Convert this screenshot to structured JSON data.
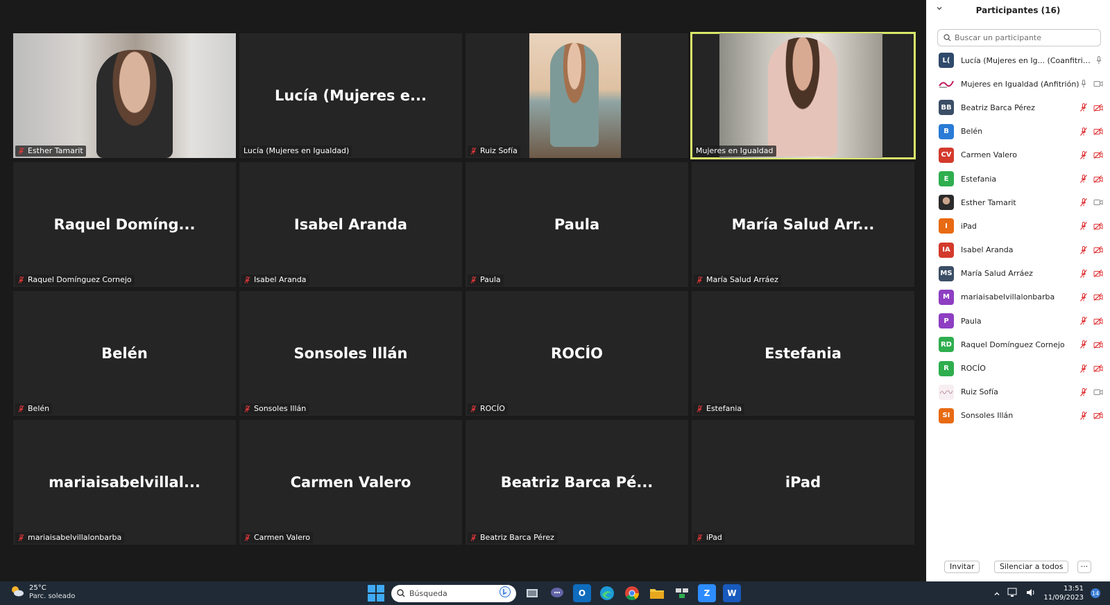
{
  "participants_panel": {
    "title": "Participantes (16)",
    "search_placeholder": "Buscar un participante",
    "participants": [
      {
        "avatar": "L(",
        "name": "Lucía (Mujeres en Ig... (Coanfitrión, yo)",
        "color": "#2f4a6b",
        "mic": "on",
        "video": "none"
      },
      {
        "avatar": "",
        "name": "Mujeres en Igualdad (Anfitrión)",
        "color": "#ffffff",
        "mic": "on",
        "video": "on",
        "avatar_icon": "mujeres-logo-icon"
      },
      {
        "avatar": "BB",
        "name": "Beatriz Barca Pérez",
        "color": "#3b4e66",
        "mic": "off",
        "video": "off"
      },
      {
        "avatar": "B",
        "name": "Belén",
        "color": "#2a7bd6",
        "mic": "off",
        "video": "off"
      },
      {
        "avatar": "CV",
        "name": "Carmen Valero",
        "color": "#d33b2c",
        "mic": "off",
        "video": "off"
      },
      {
        "avatar": "E",
        "name": "Estefania",
        "color": "#2fae4e",
        "mic": "off",
        "video": "off"
      },
      {
        "avatar": "",
        "name": "Esther Tamarit",
        "color": "#6b5a4e",
        "mic": "off",
        "video": "on",
        "avatar_icon": "photo-avatar-icon"
      },
      {
        "avatar": "I",
        "name": "iPad",
        "color": "#e86a12",
        "mic": "off",
        "video": "off"
      },
      {
        "avatar": "IA",
        "name": "Isabel Aranda",
        "color": "#d33b2c",
        "mic": "off",
        "video": "off"
      },
      {
        "avatar": "MS",
        "name": "María Salud Arráez",
        "color": "#3b4e66",
        "mic": "off",
        "video": "off"
      },
      {
        "avatar": "M",
        "name": "mariaisabelvillalonbarba",
        "color": "#8e3ec2",
        "mic": "off",
        "video": "off"
      },
      {
        "avatar": "P",
        "name": "Paula",
        "color": "#8e3ec2",
        "mic": "off",
        "video": "off"
      },
      {
        "avatar": "RD",
        "name": "Raquel Domínguez Cornejo",
        "color": "#2fae4e",
        "mic": "off",
        "video": "off"
      },
      {
        "avatar": "R",
        "name": "ROCÍO",
        "color": "#2fae4e",
        "mic": "off",
        "video": "off"
      },
      {
        "avatar": "",
        "name": "Ruiz Sofía",
        "color": "#f5e9ee",
        "mic": "off",
        "video": "on",
        "avatar_icon": "signature-avatar-icon"
      },
      {
        "avatar": "SI",
        "name": "Sonsoles Illán",
        "color": "#e86a12",
        "mic": "off",
        "video": "off"
      }
    ],
    "invite_label": "Invitar",
    "mute_all_label": "Silenciar a todos",
    "more_label": "···"
  },
  "gallery": {
    "tiles": [
      {
        "label": "Esther Tamarit",
        "big_name": "",
        "video": "esther",
        "muted": true
      },
      {
        "label": "Lucía (Mujeres en Igualdad)",
        "big_name": "Lucía (Mujeres e...",
        "video": "",
        "muted": false
      },
      {
        "label": "Ruiz Sofía",
        "big_name": "",
        "video": "ruiz",
        "muted": true
      },
      {
        "label": "Mujeres en Igualdad",
        "big_name": "",
        "video": "mujeres",
        "muted": false,
        "speaking": true
      },
      {
        "label": "Raquel Domínguez Cornejo",
        "big_name": "Raquel  Domíng...",
        "video": "",
        "muted": true
      },
      {
        "label": "Isabel Aranda",
        "big_name": "Isabel Aranda",
        "video": "",
        "muted": true
      },
      {
        "label": "Paula",
        "big_name": "Paula",
        "video": "",
        "muted": true
      },
      {
        "label": "María Salud Arráez",
        "big_name": "María Salud Arr...",
        "video": "",
        "muted": true
      },
      {
        "label": "Belén",
        "big_name": "Belén",
        "video": "",
        "muted": true
      },
      {
        "label": "Sonsoles Illán",
        "big_name": "Sonsoles Illán",
        "video": "",
        "muted": true
      },
      {
        "label": "ROCÍO",
        "big_name": "ROCÍO",
        "video": "",
        "muted": true
      },
      {
        "label": "Estefania",
        "big_name": "Estefania",
        "video": "",
        "muted": true
      },
      {
        "label": "mariaisabelvillalonbarba",
        "big_name": "mariaisabelvillal...",
        "video": "",
        "muted": true
      },
      {
        "label": "Carmen Valero",
        "big_name": "Carmen Valero",
        "video": "",
        "muted": true
      },
      {
        "label": "Beatriz Barca Pérez",
        "big_name": "Beatriz Barca Pé...",
        "video": "",
        "muted": true
      },
      {
        "label": "iPad",
        "big_name": "iPad",
        "video": "",
        "muted": true
      }
    ]
  },
  "taskbar": {
    "weather_temp": "25°C",
    "weather_cond": "Parc. soleado",
    "search_label": "Búsqueda",
    "time": "13:51",
    "date": "11/09/2023",
    "notif_count": "14"
  }
}
